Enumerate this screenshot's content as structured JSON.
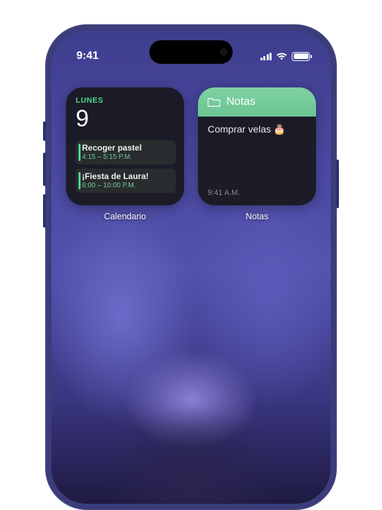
{
  "status": {
    "time": "9:41"
  },
  "widgets": {
    "calendar": {
      "label": "Calendario",
      "day_name": "LUNES",
      "date": "9",
      "events": [
        {
          "title": "Recoger pastel",
          "time": "4:15 – 5:15 P.M."
        },
        {
          "title": "¡Fiesta de Laura!",
          "time": "6:00 – 10:00 P.M."
        }
      ]
    },
    "notes": {
      "label": "Notas",
      "header_title": "Notas",
      "note_text": "Comprar velas 🎂",
      "note_time": "9:41 A.M."
    }
  }
}
